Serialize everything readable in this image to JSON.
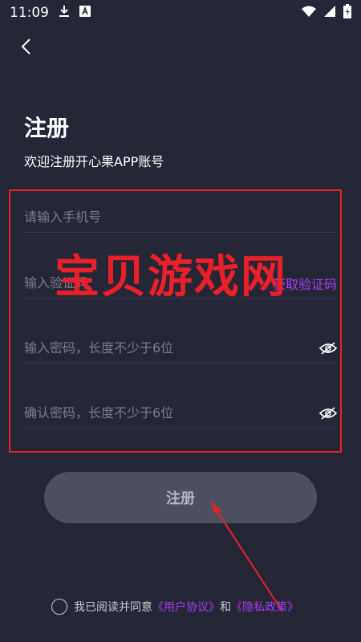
{
  "status_bar": {
    "time": "11:09",
    "icons": [
      "download-icon",
      "a-notification-icon",
      "wifi-icon",
      "signal-icon",
      "battery-icon"
    ]
  },
  "header": {
    "back_icon": "chevron-left-icon",
    "title": "注册",
    "subtitle": "欢迎注册开心果APP账号"
  },
  "form": {
    "phone_placeholder": "请输入手机号",
    "code_placeholder": "输入验证码",
    "get_code_label": "获取验证码",
    "password_placeholder": "输入密码，长度不少于6位",
    "confirm_placeholder": "确认密码，长度不少于6位",
    "eye_icon": "eye-off-icon"
  },
  "watermark": "宝贝游戏网",
  "register_label": "注册",
  "agreement": {
    "prefix": "我已阅读并同意",
    "user_agreement": "《用户协议》",
    "and": "和",
    "privacy_policy": "《隐私政策》"
  },
  "colors": {
    "background": "#252636",
    "accent": "#a63cf2",
    "annotation_red": "#e8202a",
    "button_bg": "#4f505f"
  }
}
